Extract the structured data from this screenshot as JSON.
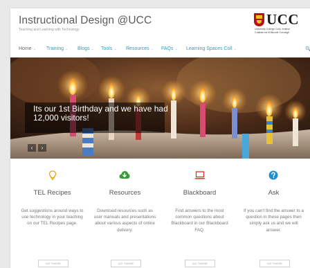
{
  "site": {
    "title": "Instructional Design @UCC",
    "tagline": "Teaching and Learning with Technology",
    "logo_text": "UCC",
    "logo_sub1": "University College Cork, Ireland",
    "logo_sub2": "Coláiste na hOllscoile Corcaigh",
    "rss_icon": "rss-icon"
  },
  "nav": {
    "items": [
      {
        "label": "Home",
        "has_dropdown": true
      },
      {
        "label": "Training",
        "has_dropdown": true
      },
      {
        "label": "Blogs",
        "has_dropdown": true
      },
      {
        "label": "Tools",
        "has_dropdown": true
      },
      {
        "label": "Resources",
        "has_dropdown": true
      },
      {
        "label": "FAQs",
        "has_dropdown": true
      },
      {
        "label": "Learning Spaces Coll",
        "has_dropdown": true
      }
    ],
    "dropdown_glyph": "⌄",
    "search_icon": "🔍"
  },
  "hero": {
    "caption": "Its our 1st Birthday and we have had 12,000 visitors!",
    "prev_glyph": "‹",
    "next_glyph": "›"
  },
  "cards": [
    {
      "icon": "lightbulb-icon",
      "title": "TEL Recipes",
      "desc": "Get suggestions around ways to use technology in your teaching on our TEL Recipes page.",
      "button": "GO THERE",
      "color": "#e8a317"
    },
    {
      "icon": "cloud-download-icon",
      "title": "Resources",
      "desc": "Download resources such as user manuals and presentations about various aspects of online delivery.",
      "button": "GO THERE",
      "color": "#3a9b3c"
    },
    {
      "icon": "laptop-icon",
      "title": "Blackboard",
      "desc": "Find answers to the most common questions about Blackboard in our Blackboard FAQ.",
      "button": "GO THERE",
      "color": "#d9342b"
    },
    {
      "icon": "question-circle-icon",
      "title": "Ask",
      "desc": "If you can't find the answer to a question in these pages then simply ask us and we will answer.",
      "button": "GO THERE",
      "color": "#1f8fd1"
    }
  ],
  "colors": {
    "link": "#29a0c7",
    "text": "#555555"
  }
}
